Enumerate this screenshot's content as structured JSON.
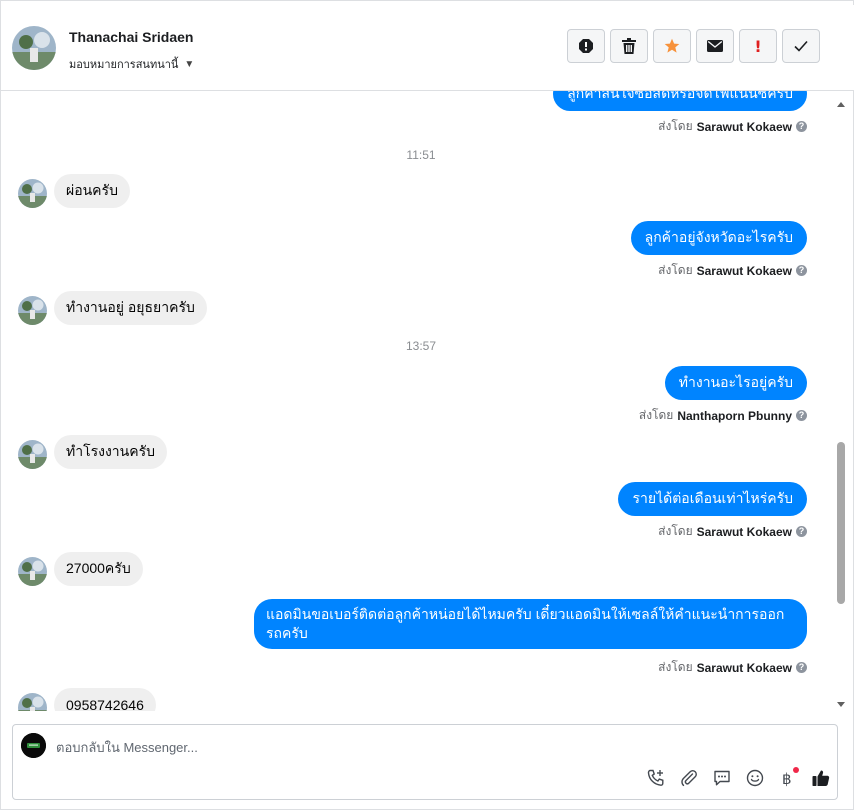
{
  "header": {
    "contact_name": "Thanachai Sridaen",
    "assign_label": "มอบหมายการสนทนานี้",
    "actions": [
      "report-icon",
      "trash-icon",
      "star-icon",
      "mail-icon",
      "important-icon",
      "check-icon"
    ]
  },
  "conversation": {
    "cut_off_message": "ลูกค้าสนใจซื้อสดหรือจัดไฟแนนซ์ครับ",
    "sent_by_prefix": "ส่งโดย",
    "items": [
      {
        "type": "sent_by",
        "agent": "Sarawut Kokaew"
      },
      {
        "type": "time",
        "text": "11:51"
      },
      {
        "type": "in",
        "text": "ผ่อนครับ"
      },
      {
        "type": "out",
        "text": "ลูกค้าอยู่จังหวัดอะไรครับ"
      },
      {
        "type": "sent_by",
        "agent": "Sarawut Kokaew"
      },
      {
        "type": "in",
        "text": "ทำงานอยู่ อยุธยาครับ"
      },
      {
        "type": "time",
        "text": "13:57"
      },
      {
        "type": "out",
        "text": "ทำงานอะไรอยู่ครับ"
      },
      {
        "type": "sent_by",
        "agent": "Nanthaporn Pbunny"
      },
      {
        "type": "in",
        "text": "ทำโรงงานครับ"
      },
      {
        "type": "out",
        "text": "รายได้ต่อเดือนเท่าไหร่ครับ"
      },
      {
        "type": "sent_by",
        "agent": "Sarawut Kokaew"
      },
      {
        "type": "in",
        "text": "27000ครับ"
      },
      {
        "type": "out",
        "text": "แอดมินขอเบอร์ติดต่อลูกค้าหน่อยได้ไหมครับ เดี๋ยวแอดมินให้เซลล์ให้คำแนะนำการออกรถครับ"
      },
      {
        "type": "sent_by",
        "agent": "Sarawut Kokaew"
      },
      {
        "type": "in",
        "text": "0958742646"
      }
    ]
  },
  "composer": {
    "placeholder": "ตอบกลับใน Messenger...",
    "tools": [
      "call-add-icon",
      "attachment-icon",
      "saved-replies-icon",
      "emoji-icon",
      "baht-icon",
      "like-icon"
    ]
  },
  "colors": {
    "outgoing_bubble": "#0084ff",
    "incoming_bubble": "#efefef",
    "star": "#f7923b",
    "important": "#e02020"
  }
}
